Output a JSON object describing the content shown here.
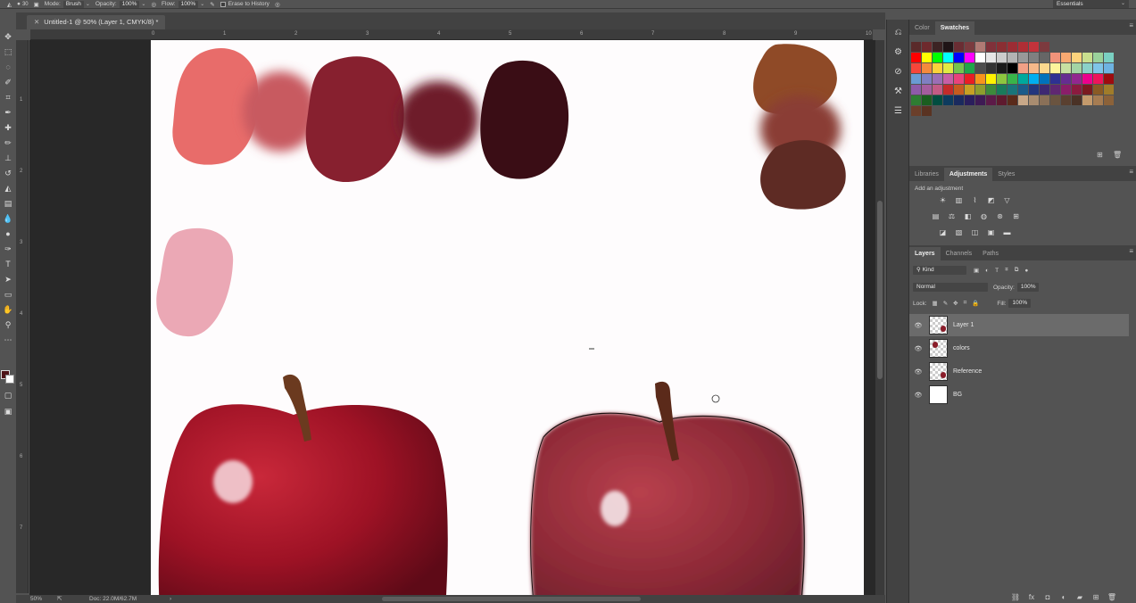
{
  "options_bar": {
    "brush_size": "30",
    "mode_label": "Mode:",
    "mode_value": "Brush",
    "opacity_label": "Opacity:",
    "opacity_value": "100%",
    "flow_label": "Flow:",
    "flow_value": "100%",
    "erase_history_label": "Erase to History",
    "workspace": "Essentials"
  },
  "document": {
    "tab_title": "Untitled-1 @ 50% (Layer 1, CMYK/8) *"
  },
  "rulers": {
    "horizontal": [
      "0",
      "1",
      "2",
      "3",
      "4",
      "5",
      "6",
      "7",
      "8",
      "9",
      "10"
    ],
    "vertical": [
      "1",
      "2",
      "3",
      "4",
      "5",
      "6",
      "7"
    ]
  },
  "status_bar": {
    "zoom": "50%",
    "doc_info": "Doc: 22.0M/62.7M"
  },
  "colors": {
    "foreground": "#4f1519",
    "background": "#ffffff"
  },
  "panels": {
    "color_tabs": [
      "Color",
      "Swatches"
    ],
    "active_color_tab": "Swatches",
    "adjustment_tabs": [
      "Libraries",
      "Adjustments",
      "Styles"
    ],
    "active_adjustment_tab": "Adjustments",
    "add_adjustment_label": "Add an adjustment",
    "layer_tabs": [
      "Layers",
      "Channels",
      "Paths"
    ],
    "active_layer_tab": "Layers"
  },
  "swatches": [
    [
      "#5a2a2a",
      "#6e2a2d",
      "#3c2323",
      "#1f1416",
      "#6a2d33",
      "#7a3b3f",
      "#b07a74",
      "#80313a",
      "#8a2e33",
      "#9c2c34",
      "#b02e35",
      "#c4333b",
      "#7c3a3e"
    ],
    [
      "#ff0000",
      "#ffff00",
      "#00ff00",
      "#00ffff",
      "#0000ff",
      "#ff00ff",
      "#ffffff",
      "#e6e6e6",
      "#cccccc",
      "#b3b3b3",
      "#999999",
      "#808080",
      "#666666",
      "#f1937a",
      "#f8a971",
      "#fdd37c",
      "#c9df8e",
      "#9ad29b",
      "#7ad0c2"
    ],
    [
      "#f7463a",
      "#f58a3c",
      "#fbd23a",
      "#e1ea43",
      "#74c44e",
      "#1fa64a",
      "#4d4d4d",
      "#333333",
      "#1a1a1a",
      "#000000",
      "#f2a086",
      "#f6b889",
      "#fbd88e",
      "#fdf49c",
      "#c7e0a1",
      "#a3d4a4",
      "#8bd1c8",
      "#7fc5e8",
      "#6eb3e2"
    ],
    [
      "#6a9bd3",
      "#7f7fc1",
      "#9b6eb5",
      "#c75ea6",
      "#e9427b",
      "#ea1c24",
      "#f7941d",
      "#fff200",
      "#8dc63f",
      "#39b54a",
      "#00a99d",
      "#00aeef",
      "#0072bc",
      "#2e3192",
      "#662d91",
      "#92278f",
      "#ec008c",
      "#ed145b",
      "#9e0b0f"
    ],
    [
      "#8e5ba8",
      "#a55d9e",
      "#c25b85",
      "#c32b2b",
      "#c75b1f",
      "#c7a024",
      "#8e9e2d",
      "#3d8a3b",
      "#197b5b",
      "#19757a",
      "#1b5b8a",
      "#23367d",
      "#3d2872",
      "#5f2771",
      "#8a1e69",
      "#8a1b3f",
      "#7a1a1f",
      "#8a5a24",
      "#a07c2a"
    ],
    [
      "#2e7d32",
      "#1b5e20",
      "#004d40",
      "#0d3b5e",
      "#1a2a5e",
      "#2a1e5c",
      "#3e1a54",
      "#5c1a48",
      "#5e1a2e",
      "#5a2a1a",
      "#c8a888",
      "#a88c70",
      "#8a7058",
      "#6a5440",
      "#5a4030",
      "#4a3226",
      "#c49a6c",
      "#a67c52",
      "#8c6239"
    ],
    [
      "#6b3f2a",
      "#5a3322"
    ]
  ],
  "adjustment_icons": [
    [
      "brightness-icon",
      "levels-icon",
      "curves-icon",
      "exposure-icon",
      "vibrance-icon"
    ],
    [
      "hue-saturation-icon",
      "color-balance-icon",
      "black-white-icon",
      "photo-filter-icon",
      "channel-mixer-icon",
      "color-lookup-icon"
    ],
    [
      "invert-icon",
      "posterize-icon",
      "threshold-icon",
      "selective-color-icon",
      "gradient-map-icon"
    ]
  ],
  "layers_panel": {
    "filter_kind": "Kind",
    "blend_mode": "Normal",
    "opacity_label": "Opacity:",
    "opacity_value": "100%",
    "lock_label": "Lock:",
    "fill_label": "Fill:",
    "fill_value": "100%",
    "layers": [
      {
        "name": "Layer 1",
        "selected": true
      },
      {
        "name": "colors",
        "selected": false
      },
      {
        "name": "Reference",
        "selected": false
      },
      {
        "name": "BG",
        "selected": false
      }
    ]
  }
}
